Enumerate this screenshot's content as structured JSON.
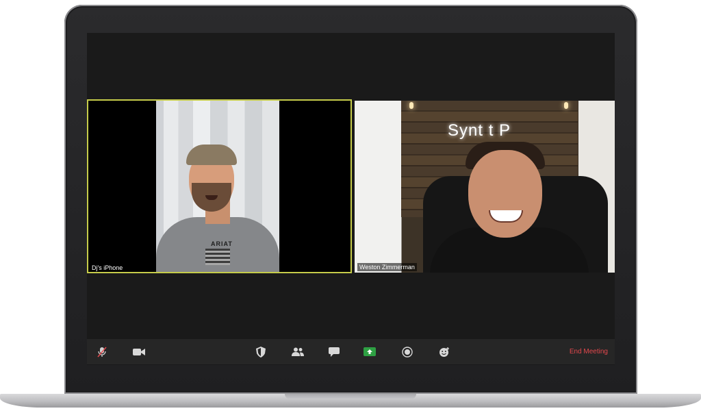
{
  "participants": [
    {
      "name": "Dj's iPhone",
      "active_speaker": true
    },
    {
      "name": "Weston Zimmerman",
      "active_speaker": false
    }
  ],
  "scene_text": {
    "shirt_brand": "ARIAT",
    "wall_sign": "Synt  t  P"
  },
  "toolbar": {
    "buttons": [
      {
        "icon": "mic-muted-icon"
      },
      {
        "icon": "video-icon"
      },
      {
        "icon": "security-shield-icon"
      },
      {
        "icon": "participants-icon"
      },
      {
        "icon": "chat-icon"
      },
      {
        "icon": "share-screen-icon"
      },
      {
        "icon": "record-icon"
      },
      {
        "icon": "reactions-icon"
      }
    ],
    "end_meeting_label": "End Meeting"
  },
  "colors": {
    "active_speaker_border": "#c6cc4a",
    "share_green": "#2ea043",
    "end_red": "#e5484d",
    "toolbar_bg": "#262626"
  }
}
